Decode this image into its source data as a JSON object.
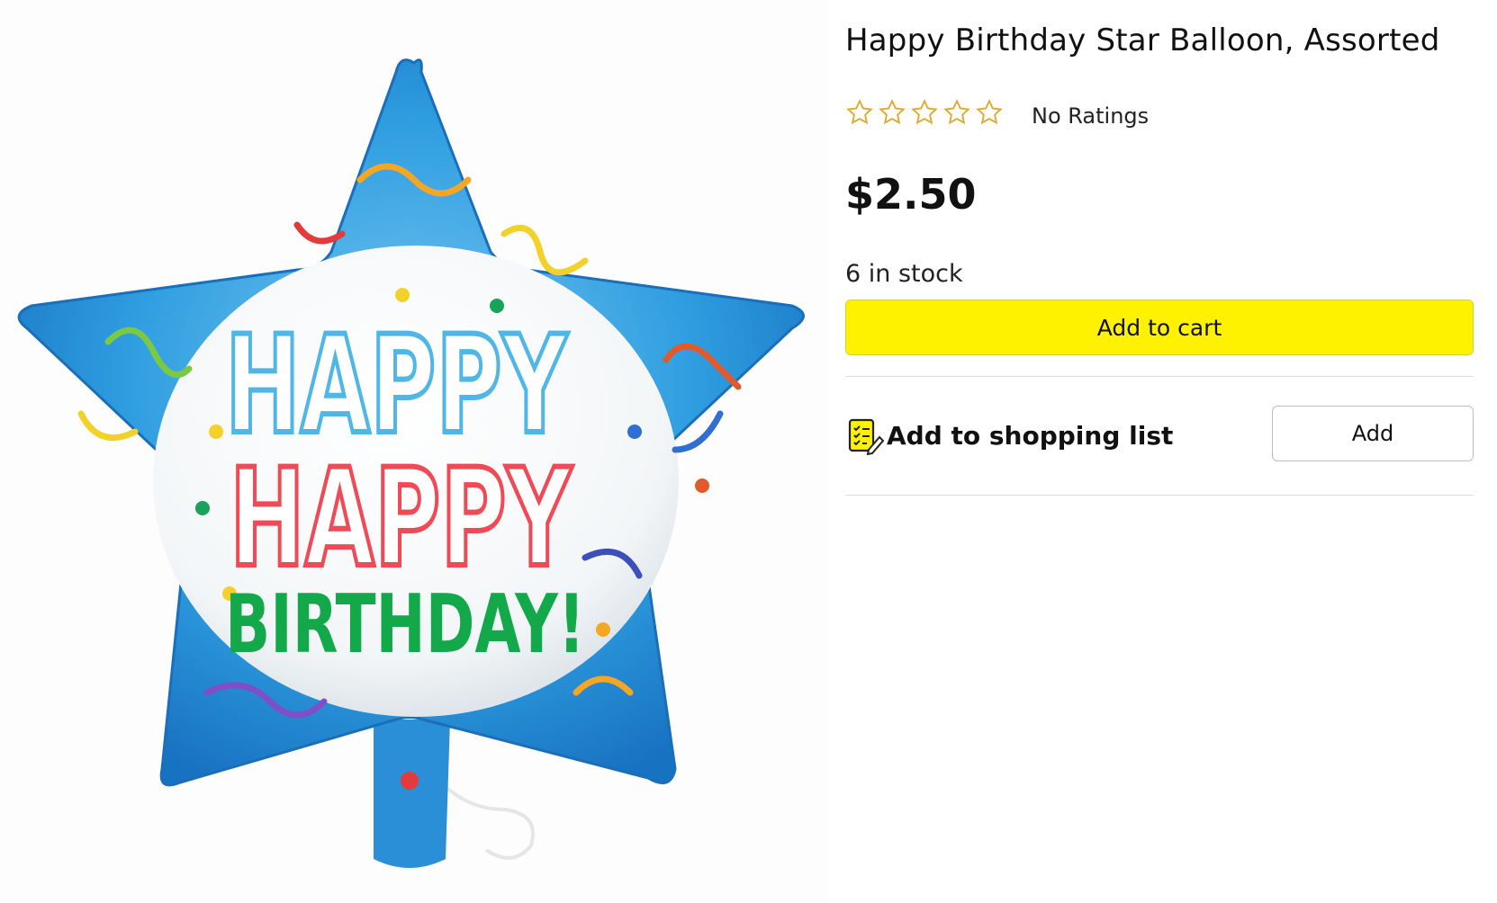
{
  "product": {
    "title": "Happy Birthday Star Balloon, Assorted",
    "rating_text": "No Ratings",
    "stars": {
      "filled": 0,
      "total": 5
    },
    "price": "$2.50",
    "stock": "6 in stock",
    "image_alt": "Blue star foil balloon"
  },
  "balloon_text": {
    "line1": "HAPPY",
    "line2": "HAPPY",
    "line3": "BIRTHDAY!"
  },
  "actions": {
    "add_to_cart": "Add to cart",
    "shopping_list_label": "Add to shopping list",
    "add_button": "Add"
  },
  "colors": {
    "cart_button": "#fff200",
    "star_outline": "#e0a82e",
    "balloon_blue": "#2f9ee0",
    "happy1": "#4fb6e6",
    "happy2": "#ef4a55",
    "birthday": "#13a84a"
  },
  "icons": {
    "star": "star-outline-icon",
    "shopping_list": "shopping-list-icon"
  }
}
